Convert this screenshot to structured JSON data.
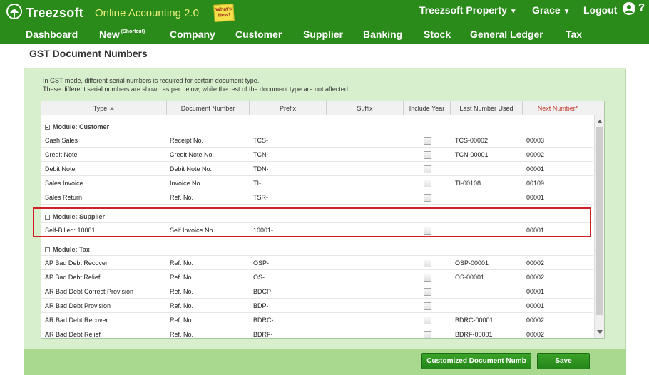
{
  "app": {
    "brand_name": "Treezsoft",
    "brand_subtitle": "Online Accounting 2.0",
    "whats_new": "What's New!",
    "company_menu": "Treezsoft Property",
    "user_menu": "Grace",
    "logout_label": "Logout",
    "help_label": "?",
    "accent_color": "#2a8a1a"
  },
  "nav": {
    "dashboard": "Dashboard",
    "new": "New",
    "new_shortcut": "(Shortcut)",
    "company": "Company",
    "customer": "Customer",
    "supplier": "Supplier",
    "banking": "Banking",
    "stock": "Stock",
    "general_ledger": "General Ledger",
    "tax": "Tax"
  },
  "page": {
    "title": "GST Document Numbers",
    "intro_line1": "In GST mode, different serial numbers is required for certain document type.",
    "intro_line2": "These different serial numbers are shown as per below, while the rest of the document type are not affected."
  },
  "grid": {
    "headers": {
      "type": "Type",
      "document_number": "Document Number",
      "prefix": "Prefix",
      "suffix": "Suffix",
      "include_year": "Include Year",
      "last_number_used": "Last Number Used",
      "next_number": "Next Number*"
    },
    "groups": [
      {
        "label": "Module: Customer",
        "rows": [
          {
            "type": "Cash Sales",
            "doc": "Receipt No.",
            "prefix": "TCS-",
            "suffix": "",
            "include_year": false,
            "last": "TCS-00002",
            "next": "00003"
          },
          {
            "type": "Credit Note",
            "doc": "Credit Note No.",
            "prefix": "TCN-",
            "suffix": "",
            "include_year": false,
            "last": "TCN-00001",
            "next": "00002"
          },
          {
            "type": "Debit Note",
            "doc": "Debit Note No.",
            "prefix": "TDN-",
            "suffix": "",
            "include_year": false,
            "last": "",
            "next": "00001"
          },
          {
            "type": "Sales Invoice",
            "doc": "Invoice No.",
            "prefix": "TI-",
            "suffix": "",
            "include_year": false,
            "last": "TI-00108",
            "next": "00109"
          },
          {
            "type": "Sales Return",
            "doc": "Ref. No.",
            "prefix": "TSR-",
            "suffix": "",
            "include_year": false,
            "last": "",
            "next": "00001"
          }
        ]
      },
      {
        "label": "Module: Supplier",
        "rows": [
          {
            "type": "Self-Billed: 10001",
            "doc": "Self Invoice No.",
            "prefix": "10001-",
            "suffix": "",
            "include_year": false,
            "last": "",
            "next": "00001"
          }
        ]
      },
      {
        "label": "Module: Tax",
        "rows": [
          {
            "type": "AP Bad Debt Recover",
            "doc": "Ref. No.",
            "prefix": "OSP-",
            "suffix": "",
            "include_year": false,
            "last": "OSP-00001",
            "next": "00002"
          },
          {
            "type": "AP Bad Debt Relief",
            "doc": "Ref. No.",
            "prefix": "OS-",
            "suffix": "",
            "include_year": false,
            "last": "OS-00001",
            "next": "00002"
          },
          {
            "type": "AR Bad Debt Correct Provision",
            "doc": "Ref. No.",
            "prefix": "BDCP-",
            "suffix": "",
            "include_year": false,
            "last": "",
            "next": "00001"
          },
          {
            "type": "AR Bad Debt Provision",
            "doc": "Ref. No.",
            "prefix": "BDP-",
            "suffix": "",
            "include_year": false,
            "last": "",
            "next": "00001"
          },
          {
            "type": "AR Bad Debt Recover",
            "doc": "Ref. No.",
            "prefix": "BDRC-",
            "suffix": "",
            "include_year": false,
            "last": "BDRC-00001",
            "next": "00002"
          },
          {
            "type": "AR Bad Debt Relief",
            "doc": "Ref. No.",
            "prefix": "BDRF-",
            "suffix": "",
            "include_year": false,
            "last": "BDRF-00001",
            "next": "00002"
          }
        ]
      }
    ]
  },
  "footer": {
    "customized_button": "Customized Document Numb",
    "save_button": "Save"
  }
}
